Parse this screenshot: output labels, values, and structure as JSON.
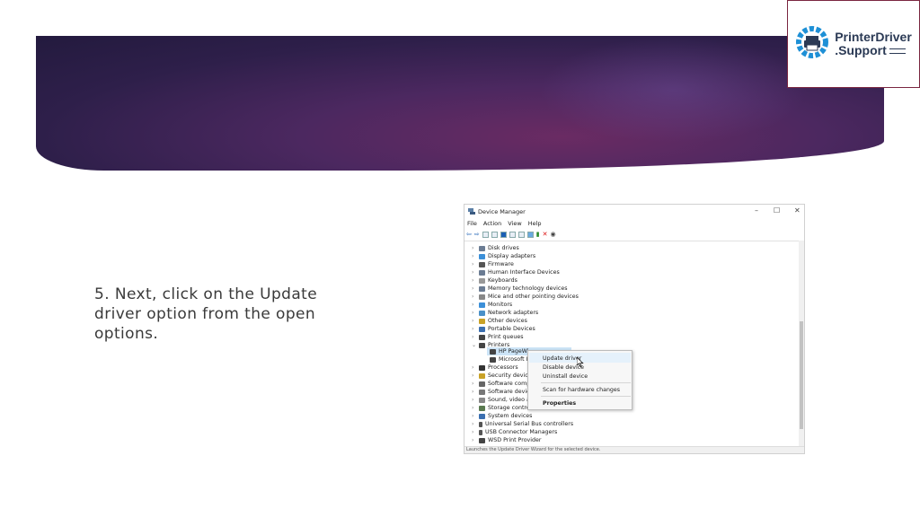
{
  "logo": {
    "line1": "PrinterDriver",
    "line2": ".Support"
  },
  "step": {
    "text": "5. Next, click on the Update driver option from the open options."
  },
  "device_manager": {
    "title": "Device Manager",
    "window_controls": {
      "minimize": "–",
      "maximize": "☐",
      "close": "✕"
    },
    "menu": [
      "File",
      "Action",
      "View",
      "Help"
    ],
    "tree": [
      {
        "label": "Disk drives",
        "expanded": false
      },
      {
        "label": "Display adapters",
        "expanded": false
      },
      {
        "label": "Firmware",
        "expanded": false
      },
      {
        "label": "Human Interface Devices",
        "expanded": false
      },
      {
        "label": "Keyboards",
        "expanded": false
      },
      {
        "label": "Memory technology devices",
        "expanded": false
      },
      {
        "label": "Mice and other pointing devices",
        "expanded": false
      },
      {
        "label": "Monitors",
        "expanded": false
      },
      {
        "label": "Network adapters",
        "expanded": false
      },
      {
        "label": "Other devices",
        "expanded": false
      },
      {
        "label": "Portable Devices",
        "expanded": false
      },
      {
        "label": "Print queues",
        "expanded": false
      },
      {
        "label": "Printers",
        "expanded": true
      },
      {
        "label": "HP PageWi",
        "child": true,
        "selected": true
      },
      {
        "label": "Microsoft I",
        "child": true
      },
      {
        "label": "Processors",
        "expanded": false
      },
      {
        "label": "Security device",
        "expanded": false
      },
      {
        "label": "Software comp",
        "expanded": false
      },
      {
        "label": "Software devic",
        "expanded": false
      },
      {
        "label": "Sound, video a",
        "expanded": false
      },
      {
        "label": "Storage contro",
        "expanded": false
      },
      {
        "label": "System devices",
        "expanded": false
      },
      {
        "label": "Universal Serial Bus controllers",
        "expanded": false
      },
      {
        "label": "USB Connector Managers",
        "expanded": false
      },
      {
        "label": "WSD Print Provider",
        "expanded": false
      }
    ],
    "status": "Launches the Update Driver Wizard for the selected device."
  },
  "context_menu": {
    "items": [
      "Update driver",
      "Disable device",
      "Uninstall device",
      "Scan for hardware changes",
      "Properties"
    ]
  },
  "colors": {
    "banner_dark": "#231a3e",
    "banner_accent": "#6a2b63",
    "logo_border": "#7a2640",
    "selection": "#cce4f7"
  }
}
